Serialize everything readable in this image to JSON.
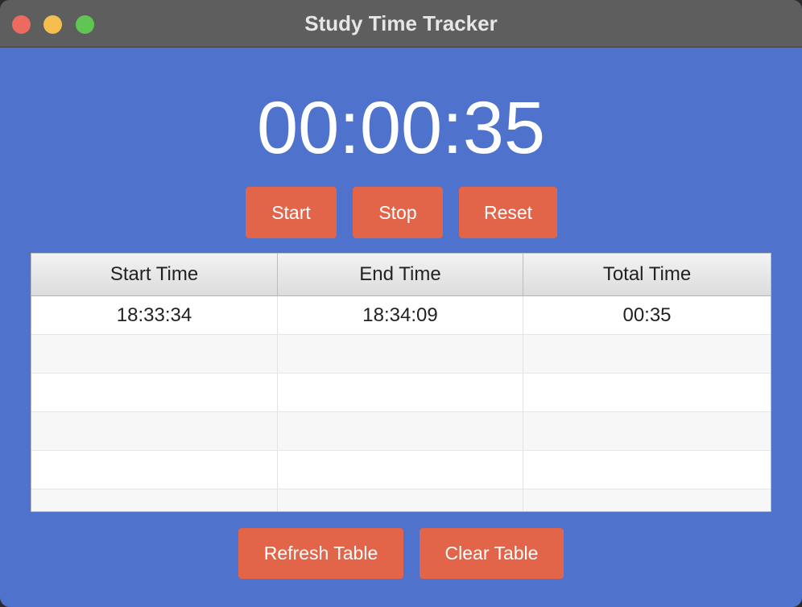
{
  "window": {
    "title": "Study Time Tracker"
  },
  "timer": {
    "display": "00:00:35"
  },
  "controls": {
    "start_label": "Start",
    "stop_label": "Stop",
    "reset_label": "Reset"
  },
  "table": {
    "columns": [
      "Start Time",
      "End Time",
      "Total Time"
    ],
    "rows": [
      [
        "18:33:34",
        "18:34:09",
        "00:35"
      ],
      [
        "",
        "",
        ""
      ],
      [
        "",
        "",
        ""
      ],
      [
        "",
        "",
        ""
      ],
      [
        "",
        "",
        ""
      ],
      [
        "",
        "",
        ""
      ]
    ]
  },
  "footer": {
    "refresh_label": "Refresh Table",
    "clear_label": "Clear Table"
  },
  "colors": {
    "background": "#4f73cc",
    "button": "#e2654a",
    "titlebar": "#5e5e5e"
  }
}
